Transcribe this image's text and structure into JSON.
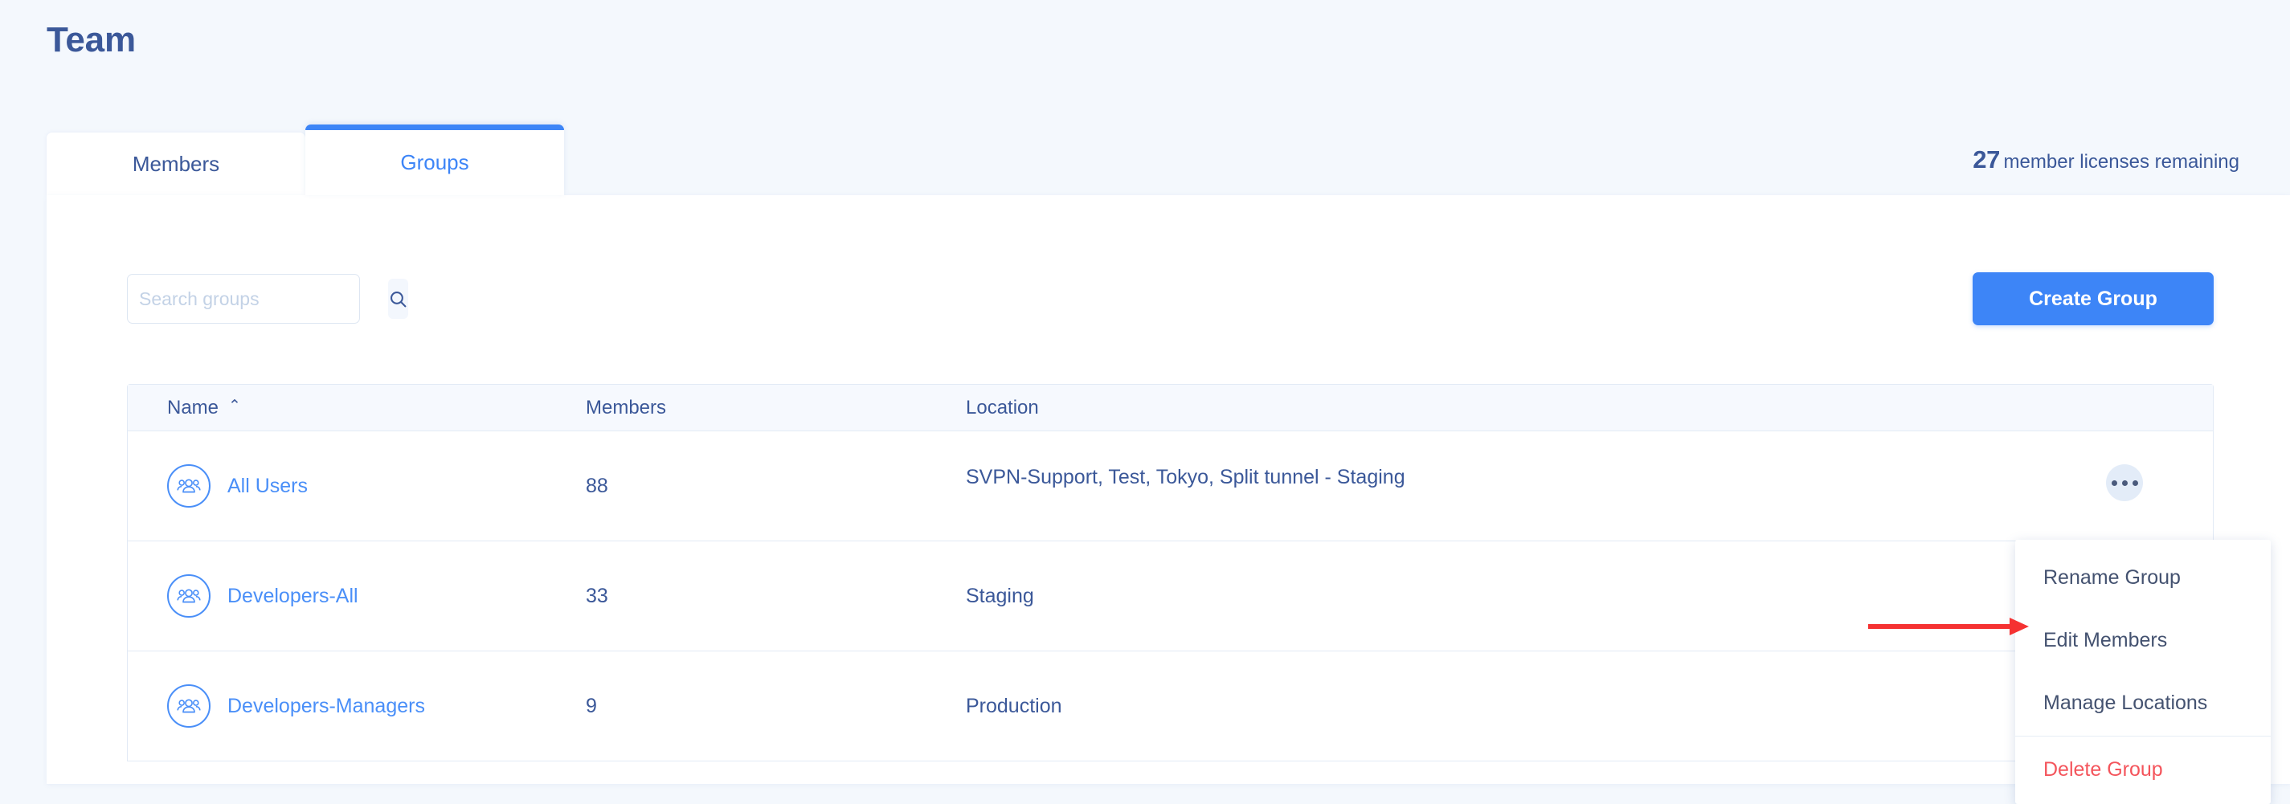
{
  "page": {
    "title": "Team"
  },
  "tabs": [
    {
      "label": "Members",
      "active": false
    },
    {
      "label": "Groups",
      "active": true
    }
  ],
  "license": {
    "count": "27",
    "text": "member licenses remaining"
  },
  "toolbar": {
    "search_placeholder": "Search groups",
    "search_value": "",
    "search_icon": "search-icon",
    "create_label": "Create Group"
  },
  "table": {
    "columns": [
      "Name",
      "Members",
      "Location"
    ],
    "sort": {
      "column": "Name",
      "direction": "asc",
      "caret": "⌃"
    },
    "rows": [
      {
        "name": "All Users",
        "members": "88",
        "location": "SVPN-Support, Test, Tokyo, Split tunnel - Staging"
      },
      {
        "name": "Developers-All",
        "members": "33",
        "location": "Staging"
      },
      {
        "name": "Developers-Managers",
        "members": "9",
        "location": "Production"
      }
    ]
  },
  "dropdown": {
    "items": [
      {
        "label": "Rename Group",
        "danger": false
      },
      {
        "label": "Edit Members",
        "danger": false
      },
      {
        "label": "Manage Locations",
        "danger": false
      },
      {
        "label": "Delete Group",
        "danger": true
      }
    ]
  },
  "annotation": {
    "target": "Edit Members",
    "color": "#f53232"
  },
  "colors": {
    "accent": "#3d85f7",
    "title": "#3b5899",
    "link": "#4a8ff8",
    "danger": "#f4555c",
    "page_bg": "#f4f8fd",
    "header_bg": "#f6f9fe",
    "border": "#e2eaf5"
  }
}
